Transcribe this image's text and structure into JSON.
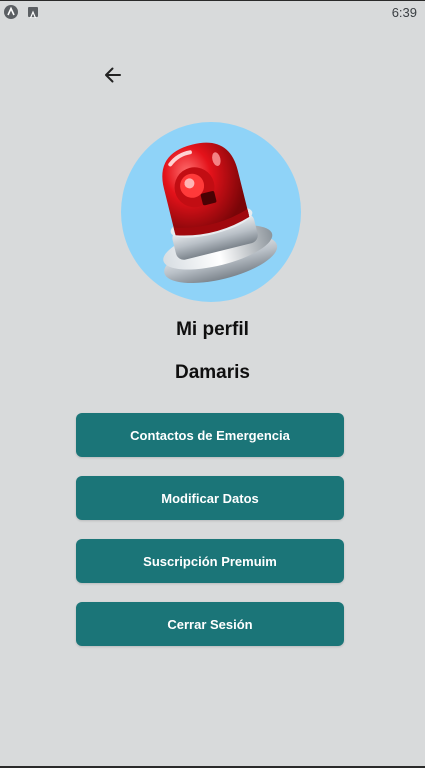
{
  "status_bar": {
    "time": "6:39"
  },
  "profile": {
    "title": "Mi perfil",
    "user_name": "Damaris",
    "avatar_icon": "siren-icon"
  },
  "menu": {
    "items": [
      {
        "label": "Contactos de Emergencia"
      },
      {
        "label": "Modificar Datos"
      },
      {
        "label": "Suscripción Premuim"
      },
      {
        "label": "Cerrar Sesión"
      }
    ]
  },
  "colors": {
    "background": "#d8dadb",
    "button": "#1b7578",
    "avatar_bg": "#8fd3f8"
  }
}
